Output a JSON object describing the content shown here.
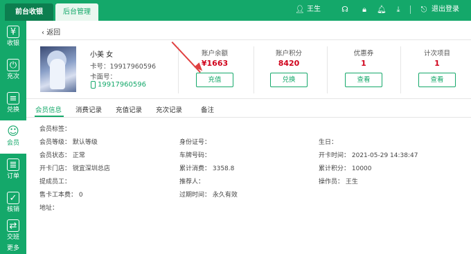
{
  "topbar": {
    "tabs": [
      {
        "label": "前台收银"
      },
      {
        "label": "后台管理"
      }
    ],
    "user_name": "王生",
    "logout_label": "退出登录"
  },
  "sidebar": {
    "items": [
      {
        "label": "收银",
        "icon": "¥"
      },
      {
        "label": "充次",
        "icon": "⏻"
      },
      {
        "label": "兑换",
        "icon": "≡"
      },
      {
        "label": "会员",
        "icon": "☺"
      },
      {
        "label": "订单",
        "icon": "≣"
      },
      {
        "label": "核销",
        "icon": "✓"
      },
      {
        "label": "交班",
        "icon": "⇄"
      },
      {
        "label": "更多",
        "icon": ""
      }
    ]
  },
  "back_label": "返回",
  "customer": {
    "name": "小美 女",
    "card_label": "卡号：19917960596",
    "face_label": "卡面号：",
    "phone": "19917960596"
  },
  "stats": [
    {
      "label": "账户余额",
      "value": "¥1663",
      "button": "充值"
    },
    {
      "label": "账户积分",
      "value": "8420",
      "button": "兑换"
    },
    {
      "label": "优惠券",
      "value": "1",
      "button": "查看"
    },
    {
      "label": "计次项目",
      "value": "1",
      "button": "查看"
    }
  ],
  "tabs": [
    {
      "label": "会员信息"
    },
    {
      "label": "消费记录"
    },
    {
      "label": "充值记录"
    },
    {
      "label": "充次记录"
    },
    {
      "label": "备注"
    }
  ],
  "fields": {
    "tag": "会员标签：",
    "level": "会员等级：  默认等级",
    "status": "会员状态：  正常",
    "store": "开卡门店：  锐宜深圳总店",
    "staff": "提成员工：",
    "fee": "售卡工本费：  0",
    "address": "地址：",
    "id_no": "身份证号：",
    "plate": "车牌号码：",
    "total_spent": "累计消费：  3358.8",
    "referrer": "推荐人：",
    "expiry": "过期时间：  永久有效",
    "birthday": "生日：",
    "open_time": "开卡时间：  2021-05-29 14:38:47",
    "total_points": "累计积分：  10000",
    "operator": "操作员：  王生"
  },
  "colors": {
    "brand": "#14a86a",
    "value_red": "#d0021b",
    "arrow": "#e04040"
  }
}
